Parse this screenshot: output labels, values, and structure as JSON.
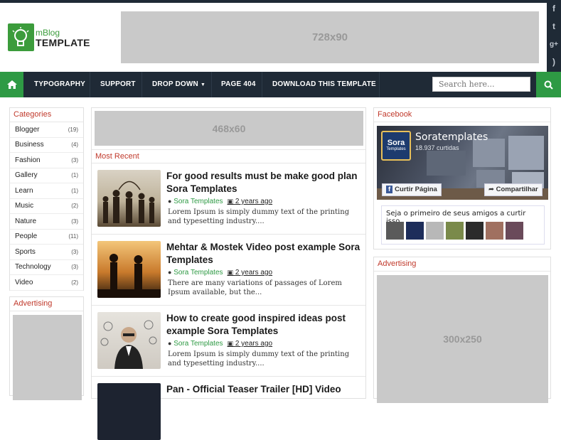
{
  "header": {
    "logo_small": "mBlog",
    "logo_big": "TEMPLATE",
    "banner_ad": "728x90",
    "social_icons": [
      "facebook-icon",
      "twitter-icon",
      "google-plus-icon",
      "rss-icon"
    ]
  },
  "nav": {
    "items": [
      "TYPOGRAPHY",
      "SUPPORT",
      "DROP DOWN",
      "PAGE 404",
      "DOWNLOAD THIS TEMPLATE"
    ],
    "search_placeholder": "Search here..."
  },
  "categories": {
    "title": "Categories",
    "items": [
      {
        "label": "Blogger",
        "count": "(19)"
      },
      {
        "label": "Business",
        "count": "(4)"
      },
      {
        "label": "Fashion",
        "count": "(3)"
      },
      {
        "label": "Gallery",
        "count": "(1)"
      },
      {
        "label": "Learn",
        "count": "(1)"
      },
      {
        "label": "Music",
        "count": "(2)"
      },
      {
        "label": "Nature",
        "count": "(3)"
      },
      {
        "label": "People",
        "count": "(11)"
      },
      {
        "label": "Sports",
        "count": "(3)"
      },
      {
        "label": "Technology",
        "count": "(3)"
      },
      {
        "label": "Video",
        "count": "(2)"
      }
    ]
  },
  "left_ad": {
    "title": "Advertising"
  },
  "main": {
    "ad": "468x60",
    "section_title": "Most Recent",
    "posts": [
      {
        "title": "For good results must be make good plan Sora Templates",
        "author": "Sora Templates",
        "date": "2 years ago",
        "excerpt": "Lorem Ipsum is simply dummy text of the printing and typesetting industry...."
      },
      {
        "title": "Mehtar & Mostek Video post example Sora Templates",
        "author": "Sora Templates",
        "date": "2 years ago",
        "excerpt": "There are many variations of passages of Lorem Ipsum available, but the..."
      },
      {
        "title": "How to create good inspired ideas post example Sora Templates",
        "author": "Sora Templates",
        "date": "2 years ago",
        "excerpt": "Lorem Ipsum is simply dummy text of the printing and typesetting industry...."
      },
      {
        "title": "Pan - Official Teaser Trailer [HD] Video",
        "author": "",
        "date": "",
        "excerpt": ""
      }
    ]
  },
  "facebook": {
    "title": "Facebook",
    "page_name": "Soratemplates",
    "likes": "18.937 curtidas",
    "logo_text": "Sora",
    "logo_sub": "Templates",
    "like_button": "Curtir Página",
    "share_button": "Compartilhar",
    "friends_text": "Seja o primeiro de seus amigos a curtir isso."
  },
  "right_ad": {
    "title": "Advertising",
    "size": "300x250"
  }
}
